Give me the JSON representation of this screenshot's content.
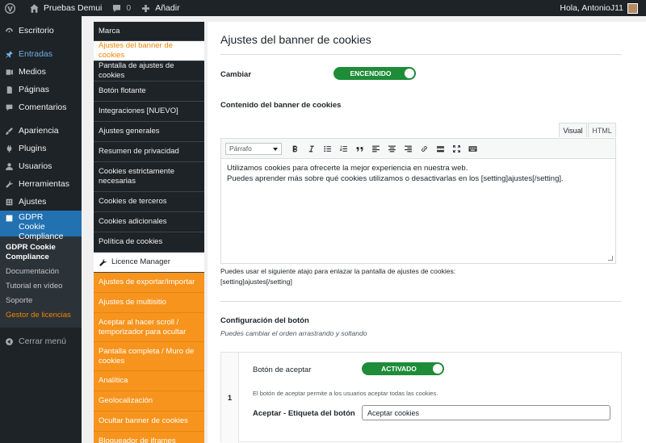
{
  "admin_bar": {
    "site_name": "Pruebas Demui",
    "comments_count": "0",
    "new_label": "Añadir",
    "greeting": "Hola, AntonioJ11"
  },
  "admin_menu": {
    "items": [
      {
        "label": "Escritorio",
        "icon": "dashboard-icon"
      },
      {
        "label": "Entradas",
        "icon": "pin-icon"
      },
      {
        "label": "Medios",
        "icon": "media-icon"
      },
      {
        "label": "Páginas",
        "icon": "pages-icon"
      },
      {
        "label": "Comentarios",
        "icon": "comments-icon"
      },
      {
        "label": "Apariencia",
        "icon": "appearance-icon"
      },
      {
        "label": "Plugins",
        "icon": "plugins-icon"
      },
      {
        "label": "Usuarios",
        "icon": "users-icon"
      },
      {
        "label": "Herramientas",
        "icon": "tools-icon"
      },
      {
        "label": "Ajustes",
        "icon": "settings-icon"
      },
      {
        "label": "GDPR Cookie Compliance",
        "icon": "checkbox-icon"
      }
    ],
    "submenu": {
      "head": "GDPR Cookie Compliance",
      "items": [
        "Documentación",
        "Tutorial en vídeo",
        "Soporte",
        "Gestor de licencias"
      ]
    },
    "collapse_label": "Cerrar menú"
  },
  "plugin_nav": {
    "dark_items": [
      "Marca"
    ],
    "selected_item": "Ajustes del banner de cookies",
    "dark_items_2": [
      "Pantalla de ajustes de cookies",
      "Botón flotante",
      "Integraciones [NUEVO]",
      "Ajustes generales",
      "Resumen de privacidad",
      "Cookies estrictamente necesarias",
      "Cookies de terceros",
      "Cookies adicionales",
      "Política de cookies"
    ],
    "licence_item": "Licence Manager",
    "orange_items": [
      "Ajustes de exportar/importar",
      "Ajustes de multisitio",
      "Aceptar al hacer scroll / temporizador para ocultar",
      "Pantalla completa / Muro de cookies",
      "Analítica",
      "Geolocalización",
      "Ocultar banner de cookies",
      "Bloqueador de iframes"
    ]
  },
  "main": {
    "title": "Ajustes del banner de cookies",
    "change_label": "Cambiar",
    "change_toggle": "ENCENDIDO",
    "content_label": "Contenido del banner de cookies",
    "tab_visual": "Visual",
    "tab_html": "HTML",
    "format_select": "Párrafo",
    "editor_line1": "Utilizamos cookies para ofrecerte la mejor experiencia en nuestra web.",
    "editor_line2": "Puedes aprender más sobre qué cookies utilizamos o desactivarlas en los [setting]ajustes[/setting].",
    "hint_line1": "Puedes usar el siguiente atajo para enlazar la pantalla de ajustes de cookies:",
    "hint_line2": "[setting]ajustes[/setting]",
    "button_config_label": "Configuración del botón",
    "button_config_hint": "Puedes cambiar el orden arrastrando y soltando",
    "button_row_number": "1",
    "accept_button_label": "Botón de aceptar",
    "accept_toggle": "ACTIVADO",
    "accept_description": "El botón de aceptar permite a los usuarios aceptar todas las cookies.",
    "accept_text_label": "Aceptar - Etiqueta del botón",
    "accept_text_value": "Aceptar cookies"
  },
  "colors": {
    "accent_orange": "#f7941d",
    "toggle_green": "#1e8c38",
    "wp_blue": "#2271b1"
  }
}
